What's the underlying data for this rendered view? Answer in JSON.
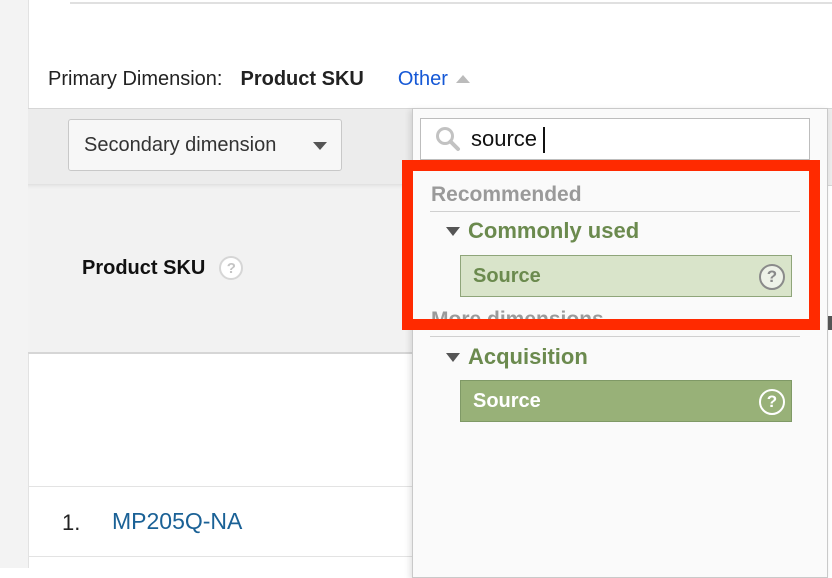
{
  "primary_dimension": {
    "label": "Primary Dimension:",
    "value": "Product SKU",
    "other_label": "Other"
  },
  "secondary_dimension": {
    "label": "Secondary dimension"
  },
  "table": {
    "column_header": "Product SKU",
    "help_glyph": "?",
    "rows": [
      {
        "index": "1.",
        "sku": "MP205Q-NA"
      }
    ]
  },
  "dropdown": {
    "search_value": "source",
    "sections": {
      "recommended": "Recommended",
      "more_dimensions": "More dimensions"
    },
    "groups": {
      "commonly_used": {
        "title": "Commonly used",
        "options": [
          "Source"
        ]
      },
      "acquisition": {
        "title": "Acquisition",
        "options": [
          "Source"
        ]
      }
    },
    "help_glyph": "?"
  },
  "colors": {
    "link": "#1558d6",
    "sku_link": "#1a6196",
    "group_title": "#6b8a4e",
    "option_light": "#d9e4ca",
    "option_dark": "#98b178",
    "highlight": "#ff2a00"
  }
}
